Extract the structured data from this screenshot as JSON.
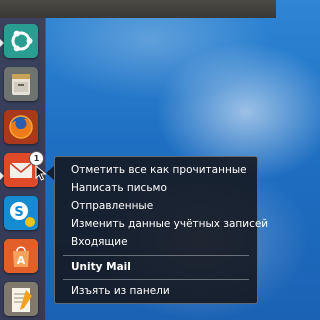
{
  "launcher": {
    "items": [
      {
        "name": "ubuntu-dash",
        "icon": "ubuntu-logo-icon"
      },
      {
        "name": "files",
        "icon": "file-cabinet-icon"
      },
      {
        "name": "firefox",
        "icon": "firefox-icon"
      },
      {
        "name": "unity-mail",
        "icon": "envelope-icon",
        "badge": "1"
      },
      {
        "name": "skype",
        "icon": "skype-icon"
      },
      {
        "name": "software-center",
        "icon": "shopping-bag-icon"
      },
      {
        "name": "text-editor",
        "icon": "notepad-icon"
      }
    ],
    "accent_colors": {
      "launcher_bg": "#3e303c",
      "ubuntu": "#2aa094",
      "firefox": "#e66000",
      "mail": "#e8522e",
      "skype": "#1a8fd6",
      "software": "#e8642a"
    }
  },
  "context_menu": {
    "items": [
      {
        "label": "Отметить все как прочитанные"
      },
      {
        "label": "Написать письмо"
      },
      {
        "label": "Отправленные"
      },
      {
        "label": "Изменить данные учётных записей"
      },
      {
        "label": "Входящие"
      }
    ],
    "title": "Unity Mail",
    "remove_label": "Изъять из панели"
  }
}
